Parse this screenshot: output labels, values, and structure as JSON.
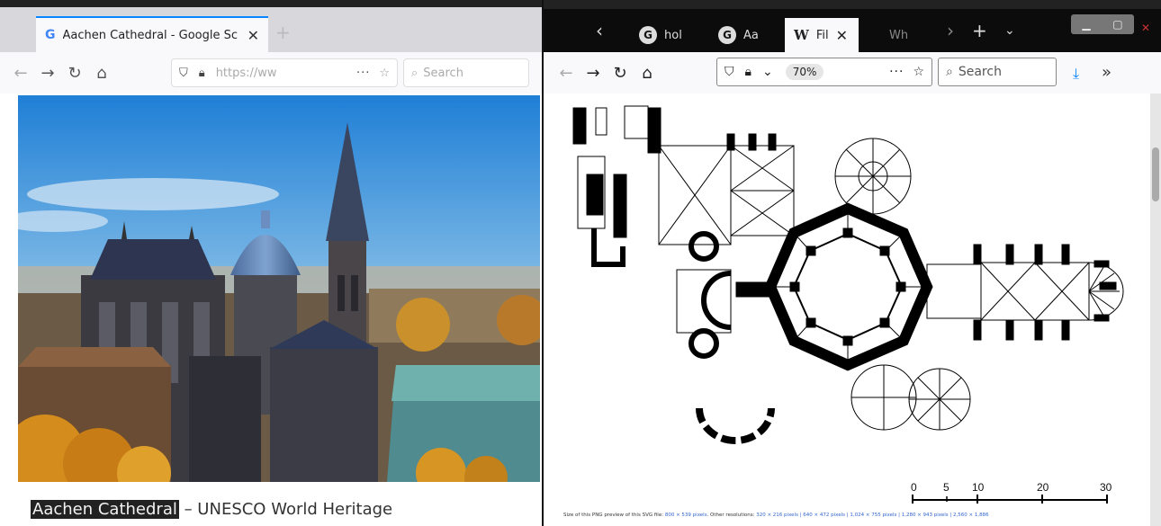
{
  "left_window": {
    "tab": {
      "icon": "google-g-icon",
      "title": "Aachen Cathedral - Google Sc"
    },
    "toolbar": {
      "url": "https://ww",
      "more": "···",
      "search_placeholder": "Search"
    },
    "caption": {
      "highlight": "Aachen Cathedral",
      "rest": " – UNESCO World Heritage"
    }
  },
  "right_window": {
    "tabs": [
      {
        "icon": "G",
        "label": "hol"
      },
      {
        "icon": "G",
        "label": "Aa"
      },
      {
        "icon": "W",
        "label": "Fil",
        "active": true
      },
      {
        "icon": "",
        "label": "Wh"
      }
    ],
    "toolbar": {
      "zoom": "70%",
      "more": "···",
      "search_placeholder": "Search"
    },
    "footer": {
      "prefix": "Size of this PNG preview of this SVG file: ",
      "size_link": "800 × 539 pixels",
      "other": ". Other resolutions: ",
      "resolutions": "320 × 216 pixels | 640 × 472 pixels | 1,024 × 755 pixels | 1,280 × 943 pixels | 2,560 × 1,886"
    },
    "scale": {
      "ticks": [
        "0",
        "5",
        "10",
        "20",
        "30"
      ]
    }
  }
}
